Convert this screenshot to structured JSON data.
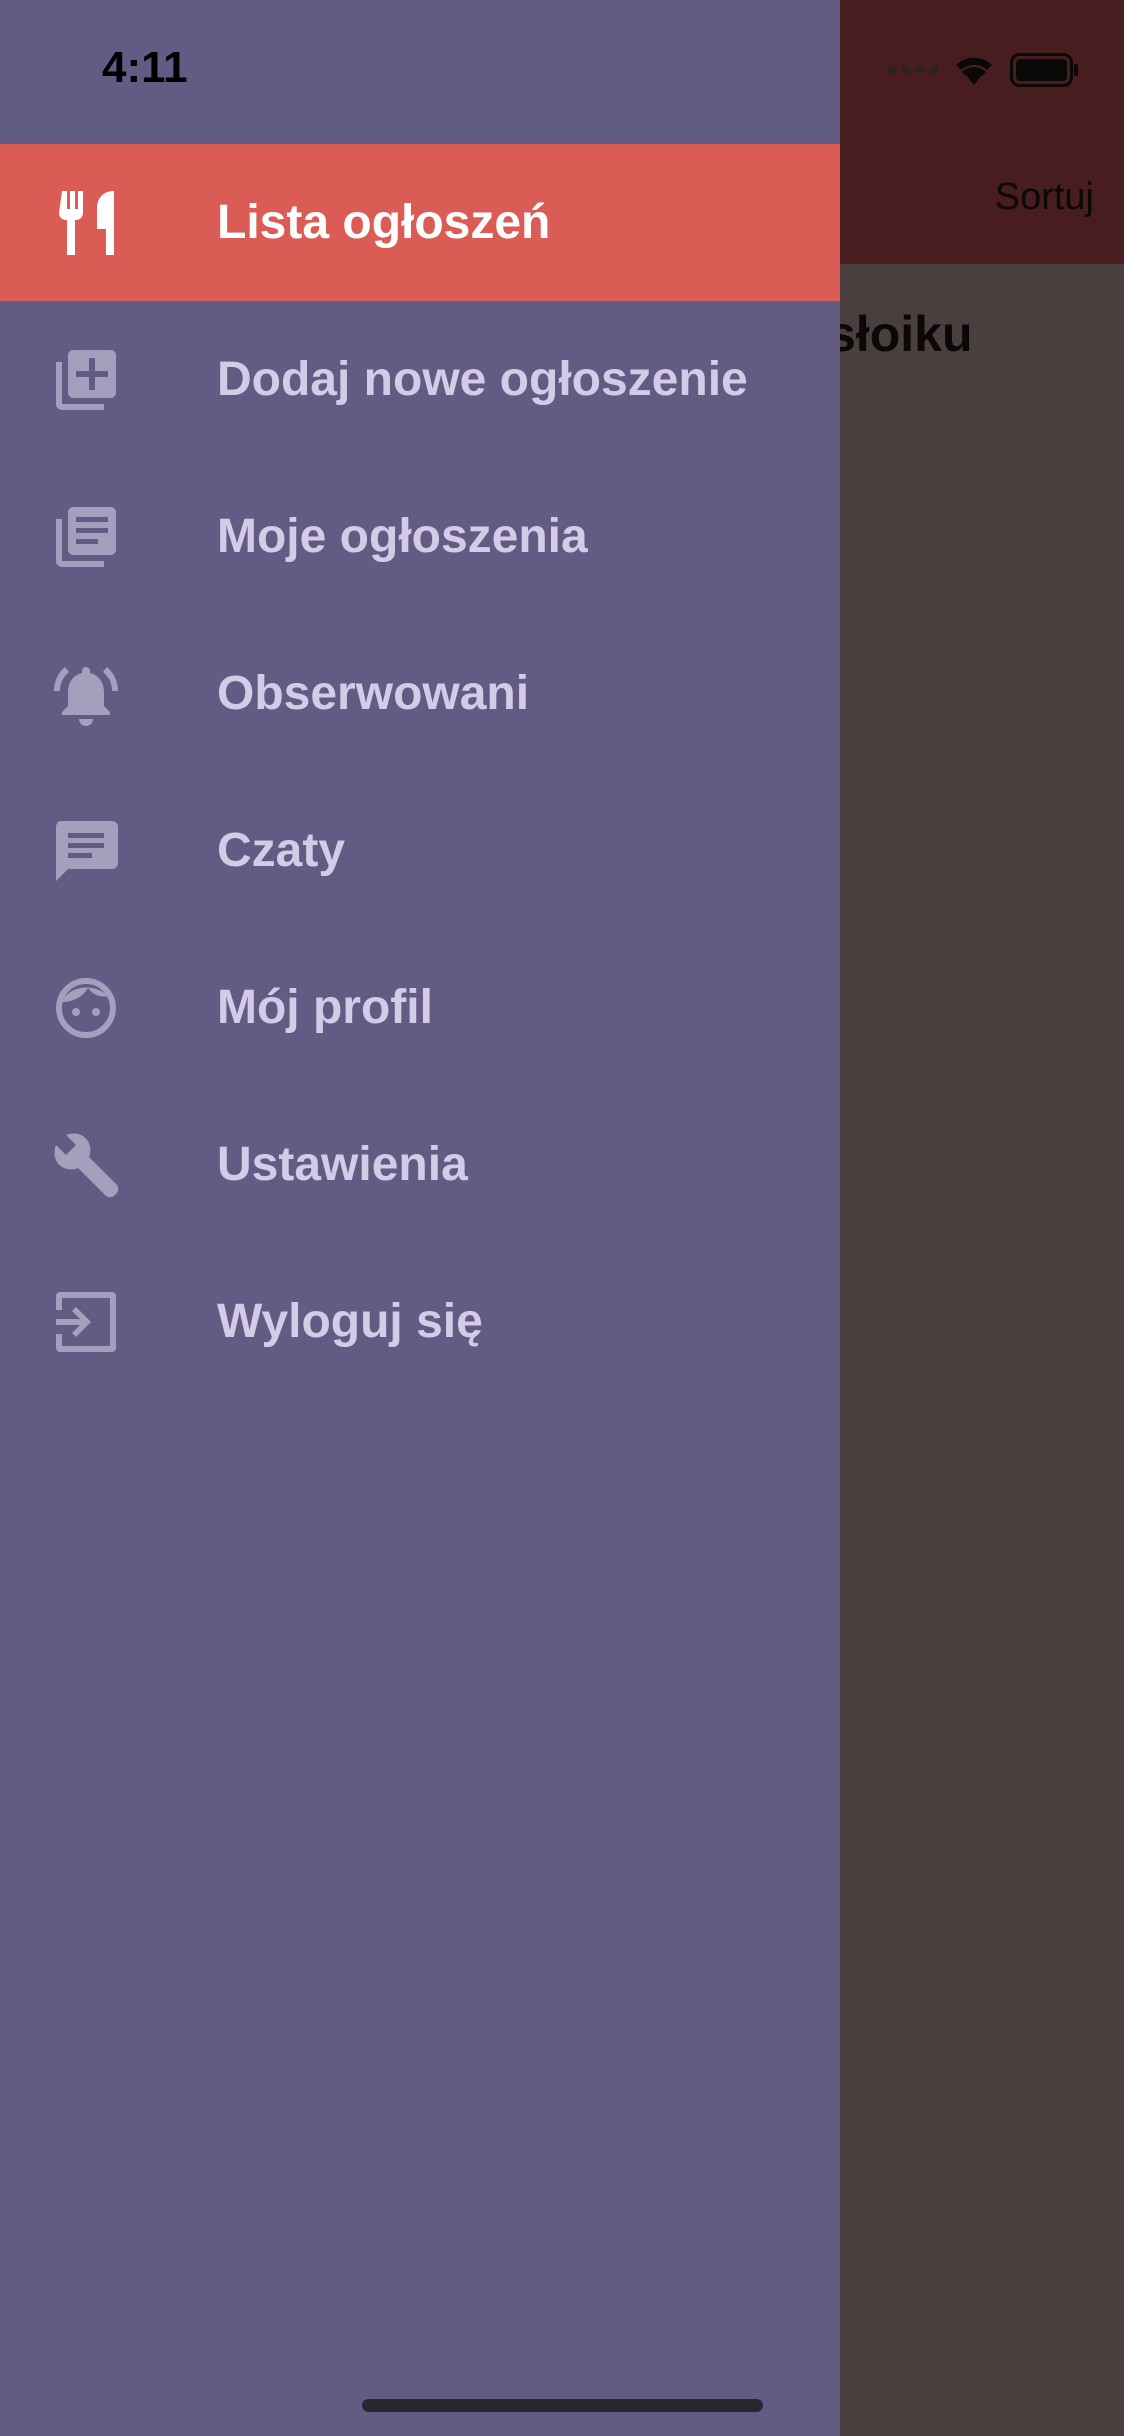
{
  "status_bar": {
    "time": "4:11"
  },
  "background": {
    "sort_label": "Sortuj",
    "title_fragment": "słoiku"
  },
  "colors": {
    "drawer_bg": "#625b84",
    "active_item_bg": "#db5b55",
    "label_color": "#d4cbe6",
    "active_label_color": "#ffffff"
  },
  "menu": {
    "items": [
      {
        "label": "Lista ogłoszeń",
        "icon": "fork-knife-icon",
        "active": true
      },
      {
        "label": "Dodaj nowe ogłoszenie",
        "icon": "add-library-icon",
        "active": false
      },
      {
        "label": "Moje ogłoszenia",
        "icon": "library-books-icon",
        "active": false
      },
      {
        "label": "Obserwowani",
        "icon": "ringing-bell-icon",
        "active": false
      },
      {
        "label": "Czaty",
        "icon": "chat-icon",
        "active": false
      },
      {
        "label": "Mój profil",
        "icon": "face-icon",
        "active": false
      },
      {
        "label": "Ustawienia",
        "icon": "wrench-icon",
        "active": false
      },
      {
        "label": "Wyloguj się",
        "icon": "logout-icon",
        "active": false
      }
    ]
  }
}
